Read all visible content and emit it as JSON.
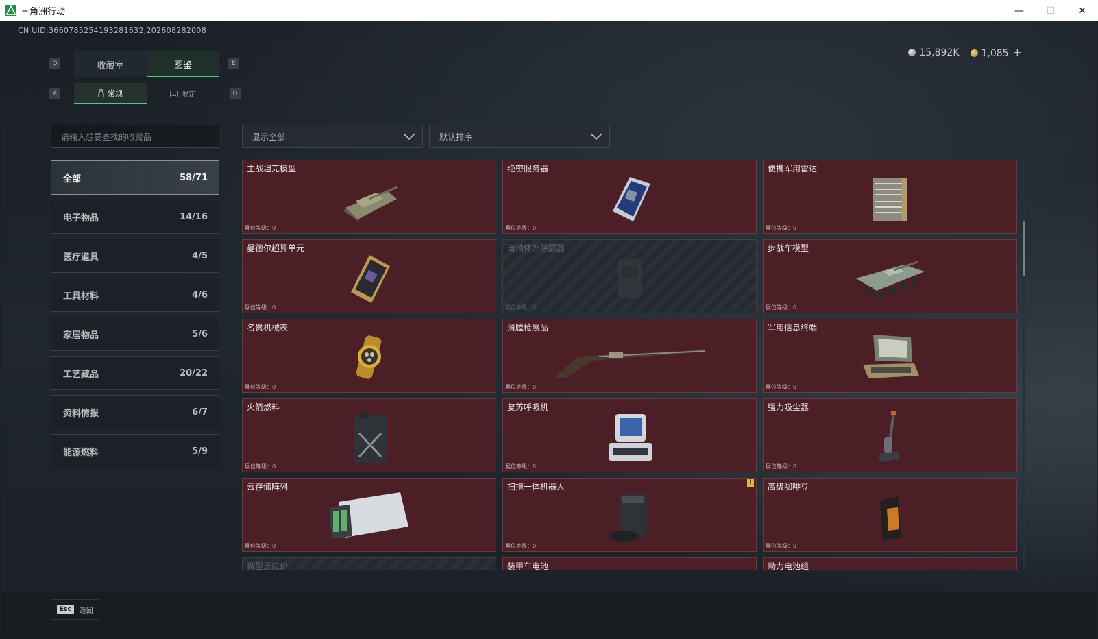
{
  "window": {
    "title": "三角洲行动",
    "controls": [
      "—",
      "☐",
      "✕"
    ]
  },
  "uid_text": "CN UID:3660785254193281632,2026082820​08",
  "currency": {
    "silver": "15,892K",
    "gold": "1,085",
    "add_label": "+"
  },
  "key_hints": {
    "prev_tab": "Q",
    "next_tab": "E",
    "prev_sub": "A",
    "next_sub": "D"
  },
  "main_tabs": [
    {
      "label": "收藏室",
      "active": false
    },
    {
      "label": "图鉴",
      "active": true
    }
  ],
  "sub_tabs": [
    {
      "label": "常规",
      "active": true,
      "icon": "bottle-icon"
    },
    {
      "label": "限定",
      "active": false,
      "icon": "image-icon"
    }
  ],
  "search": {
    "placeholder": "请输入想要查找的收藏品"
  },
  "filters": {
    "display": "显示全部",
    "sort": "默认排序"
  },
  "categories": [
    {
      "label": "全部",
      "count": "58/71",
      "active": true
    },
    {
      "label": "电子物品",
      "count": "14/16",
      "active": false
    },
    {
      "label": "医疗道具",
      "count": "4/5",
      "active": false
    },
    {
      "label": "工具材料",
      "count": "4/6",
      "active": false
    },
    {
      "label": "家居物品",
      "count": "5/6",
      "active": false
    },
    {
      "label": "工艺藏品",
      "count": "20/22",
      "active": false
    },
    {
      "label": "资料情报",
      "count": "6/7",
      "active": false
    },
    {
      "label": "能源燃料",
      "count": "5/9",
      "active": false
    }
  ],
  "level_label": "展位等级：",
  "items": [
    {
      "name": "主战坦克模型",
      "level": "0",
      "locked": false,
      "icon": "tank-icon"
    },
    {
      "name": "绝密服务器",
      "level": "0",
      "locked": false,
      "icon": "server-icon"
    },
    {
      "name": "便携军用雷达",
      "level": "0",
      "locked": false,
      "icon": "radar-icon"
    },
    {
      "name": "曼德尔超算单元",
      "level": "0",
      "locked": false,
      "icon": "gpu-icon"
    },
    {
      "name": "自动体外除颤器",
      "level": "0",
      "locked": true,
      "icon": "defibrillator-icon"
    },
    {
      "name": "步战车模型",
      "level": "0",
      "locked": false,
      "icon": "ifv-icon"
    },
    {
      "name": "名贵机械表",
      "level": "0",
      "locked": false,
      "icon": "watch-icon"
    },
    {
      "name": "滑膛枪展品",
      "level": "0",
      "locked": false,
      "icon": "musket-icon"
    },
    {
      "name": "军用信息终端",
      "level": "0",
      "locked": false,
      "icon": "terminal-icon"
    },
    {
      "name": "火箭燃料",
      "level": "0",
      "locked": false,
      "icon": "jerrycan-icon"
    },
    {
      "name": "复苏呼吸机",
      "level": "0",
      "locked": false,
      "icon": "ventilator-icon"
    },
    {
      "name": "强力吸尘器",
      "level": "0",
      "locked": false,
      "icon": "vacuum-icon"
    },
    {
      "name": "云存储阵列",
      "level": "0",
      "locked": false,
      "icon": "storage-array-icon"
    },
    {
      "name": "扫拖一体机器人",
      "level": "0",
      "locked": false,
      "icon": "robot-mop-icon",
      "warning": "!"
    },
    {
      "name": "高级咖啡豆",
      "level": "0",
      "locked": false,
      "icon": "coffee-bag-icon"
    },
    {
      "name": "微型反应炉",
      "level": "0",
      "locked": true,
      "icon": "reactor-icon"
    },
    {
      "name": "装甲车电池",
      "level": "0",
      "locked": false,
      "icon": "battery-icon"
    },
    {
      "name": "动力电池组",
      "level": "0",
      "locked": false,
      "icon": "battery-pack-icon"
    }
  ],
  "footer": {
    "esc_key": "Esc",
    "back_label": "返回"
  }
}
